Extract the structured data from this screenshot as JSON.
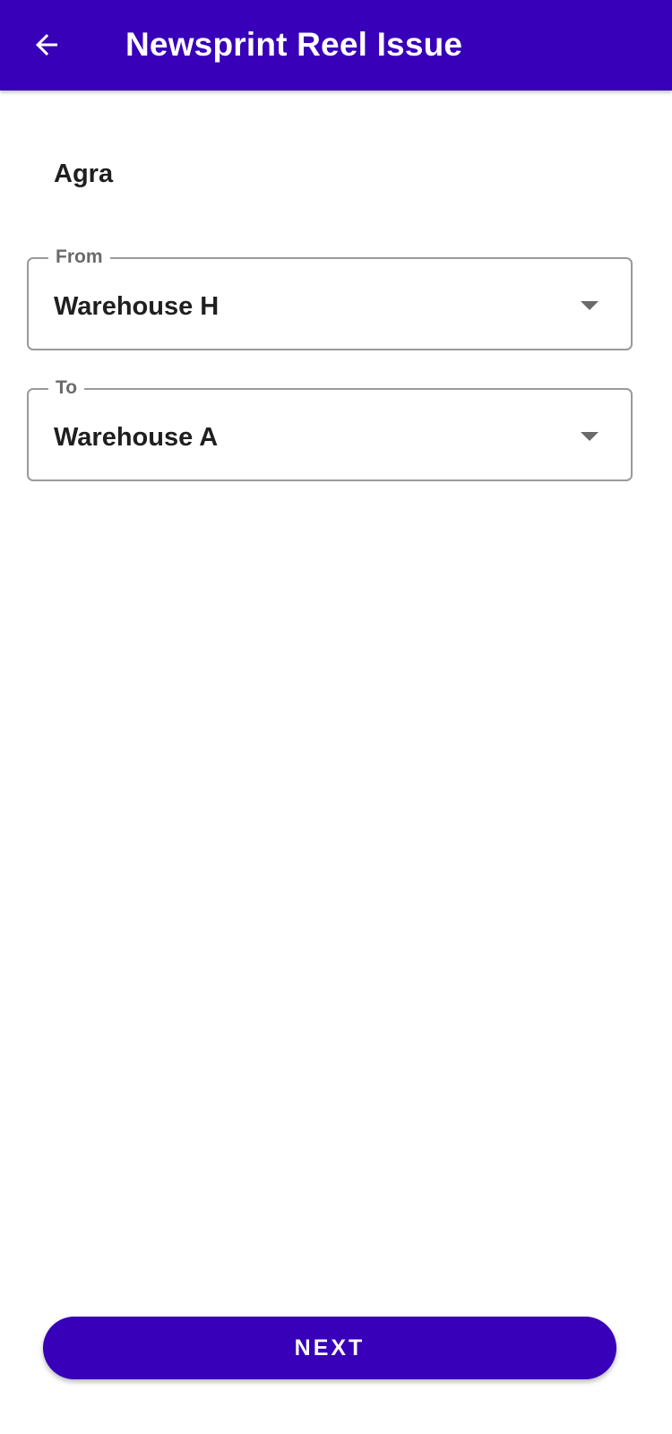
{
  "appbar": {
    "title": "Newsprint Reel Issue",
    "back_icon": "arrow-left-icon",
    "color": "#3800b8"
  },
  "location": "Agra",
  "from_field": {
    "label": "From",
    "value": "Warehouse H",
    "icon": "dropdown-caret-icon"
  },
  "to_field": {
    "label": "To",
    "value": "Warehouse A",
    "icon": "dropdown-caret-icon"
  },
  "next_button": {
    "label": "NEXT"
  }
}
